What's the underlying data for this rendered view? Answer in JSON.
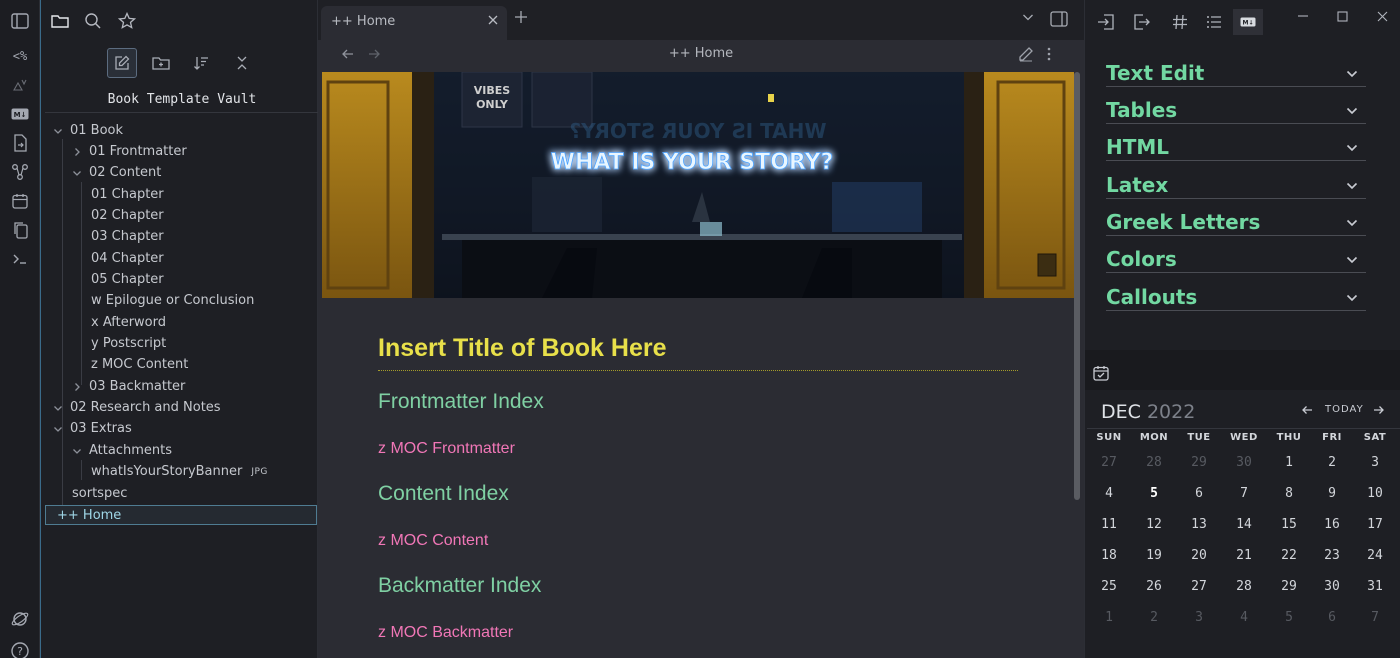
{
  "explorer": {
    "vault_name": "Book Template Vault",
    "tree": [
      {
        "label": "01 Book"
      },
      {
        "label": "01 Frontmatter"
      },
      {
        "label": "02 Content"
      },
      {
        "label": "01 Chapter"
      },
      {
        "label": "02 Chapter"
      },
      {
        "label": "03 Chapter"
      },
      {
        "label": "04 Chapter"
      },
      {
        "label": "05 Chapter"
      },
      {
        "label": "w Epilogue or Conclusion"
      },
      {
        "label": "x Afterword"
      },
      {
        "label": "y Postscript"
      },
      {
        "label": "z MOC Content"
      },
      {
        "label": "03 Backmatter"
      },
      {
        "label": "02 Research and Notes"
      },
      {
        "label": "03 Extras"
      },
      {
        "label": "Attachments"
      },
      {
        "label": "whatIsYourStoryBanner",
        "badge": "JPG"
      },
      {
        "label": "sortspec"
      }
    ],
    "active_item": "++ Home"
  },
  "tabs": {
    "active_tab": "++ Home"
  },
  "view": {
    "title": "++ Home"
  },
  "banner": {
    "neon_text": "WHAT IS YOUR STORY?"
  },
  "document": {
    "title": "Insert Title of Book Here",
    "sections": [
      {
        "heading": "Frontmatter Index",
        "link": "z MOC Frontmatter"
      },
      {
        "heading": "Content Index",
        "link": "z MOC Content"
      },
      {
        "heading": "Backmatter Index",
        "link": "z MOC Backmatter"
      }
    ]
  },
  "snippets": {
    "items": [
      "Text Edit",
      "Tables",
      "HTML",
      "Latex",
      "Greek Letters",
      "Colors",
      "Callouts"
    ]
  },
  "calendar": {
    "month": "DEC",
    "year": "2022",
    "today_label": "TODAY",
    "weekdays": [
      "SUN",
      "MON",
      "TUE",
      "WED",
      "THU",
      "FRI",
      "SAT"
    ],
    "weeks": [
      [
        "27",
        "28",
        "29",
        "30",
        "1",
        "2",
        "3"
      ],
      [
        "4",
        "5",
        "6",
        "7",
        "8",
        "9",
        "10"
      ],
      [
        "11",
        "12",
        "13",
        "14",
        "15",
        "16",
        "17"
      ],
      [
        "18",
        "19",
        "20",
        "21",
        "22",
        "23",
        "24"
      ],
      [
        "25",
        "26",
        "27",
        "28",
        "29",
        "30",
        "31"
      ],
      [
        "1",
        "2",
        "3",
        "4",
        "5",
        "6",
        "7"
      ]
    ],
    "today": "5"
  },
  "colors": {
    "title_yellow": "#e8e04a",
    "heading_green": "#7fd0a3",
    "link_pink": "#f177b7",
    "snippet_green": "#72d8a2"
  }
}
